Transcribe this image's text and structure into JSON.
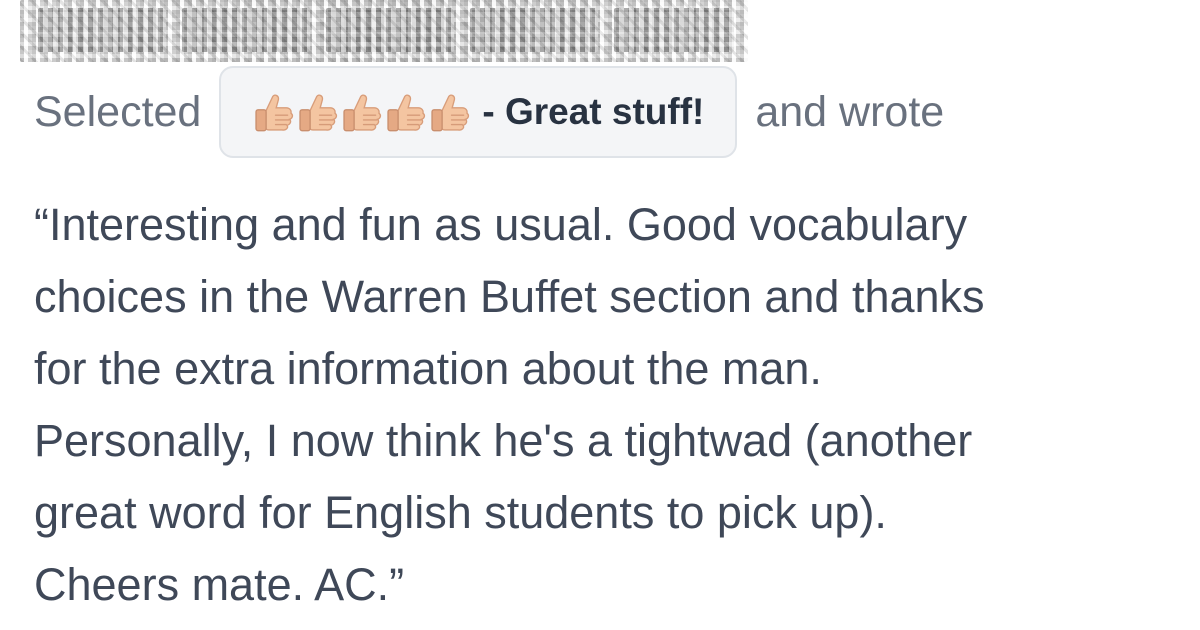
{
  "review": {
    "prefix": "Selected",
    "rating": {
      "icon": "thumbs-up-icon",
      "count": 5,
      "label": "- Great stuff!"
    },
    "suffix": "and wrote",
    "comment": "“Interesting and fun as usual. Good vocabulary\nchoices in the Warren Buffet section and thanks\nfor the extra information about the man.\nPersonally, I now think he's a tightwad (another\ngreat word for English students to pick up).\nCheers mate. AC.”"
  },
  "colors": {
    "text": "#3f4858",
    "muted": "#69717e",
    "chip_background": "#f4f5f7",
    "chip_border": "#dfe3e8"
  }
}
